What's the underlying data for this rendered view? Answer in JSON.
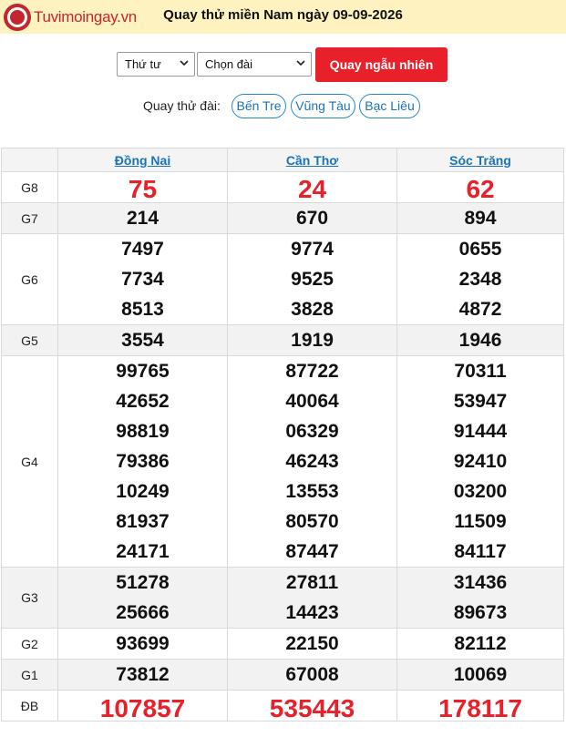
{
  "header": {
    "logo_text": "Tuvimoingay.vn",
    "title": "Quay thử miền Nam ngày 09-09-2026"
  },
  "controls": {
    "day_select": "Thứ tư",
    "station_select": "Chọn đài",
    "random_button": "Quay ngẫu nhiên"
  },
  "quick": {
    "label": "Quay thử đài:",
    "stations": [
      "Bến Tre",
      "Vũng Tàu",
      "Bạc Liêu"
    ]
  },
  "table": {
    "columns": [
      "Đồng Nai",
      "Cần Thơ",
      "Sóc Trăng"
    ],
    "rows": [
      {
        "prize": "G8",
        "values": [
          [
            "75"
          ],
          [
            "24"
          ],
          [
            "62"
          ]
        ]
      },
      {
        "prize": "G7",
        "values": [
          [
            "214"
          ],
          [
            "670"
          ],
          [
            "894"
          ]
        ]
      },
      {
        "prize": "G6",
        "values": [
          [
            "7497",
            "7734",
            "8513"
          ],
          [
            "9774",
            "9525",
            "3828"
          ],
          [
            "0655",
            "2348",
            "4872"
          ]
        ]
      },
      {
        "prize": "G5",
        "values": [
          [
            "3554"
          ],
          [
            "1919"
          ],
          [
            "1946"
          ]
        ]
      },
      {
        "prize": "G4",
        "values": [
          [
            "99765",
            "42652",
            "98819",
            "79386",
            "10249",
            "81937",
            "24171"
          ],
          [
            "87722",
            "40064",
            "06329",
            "46243",
            "13553",
            "80570",
            "87447"
          ],
          [
            "70311",
            "53947",
            "91444",
            "92410",
            "03200",
            "11509",
            "84117"
          ]
        ]
      },
      {
        "prize": "G3",
        "values": [
          [
            "51278",
            "25666"
          ],
          [
            "27811",
            "14423"
          ],
          [
            "31436",
            "89673"
          ]
        ]
      },
      {
        "prize": "G2",
        "values": [
          [
            "93699"
          ],
          [
            "22150"
          ],
          [
            "82112"
          ]
        ]
      },
      {
        "prize": "G1",
        "values": [
          [
            "73812"
          ],
          [
            "67008"
          ],
          [
            "10069"
          ]
        ]
      },
      {
        "prize": "ĐB",
        "values": [
          [
            "107857"
          ],
          [
            "535443"
          ],
          [
            "178117"
          ]
        ]
      }
    ]
  },
  "colors": {
    "accent_red": "#e8202a",
    "link_blue": "#1a73b8",
    "header_bg": "#fdf2c0"
  }
}
